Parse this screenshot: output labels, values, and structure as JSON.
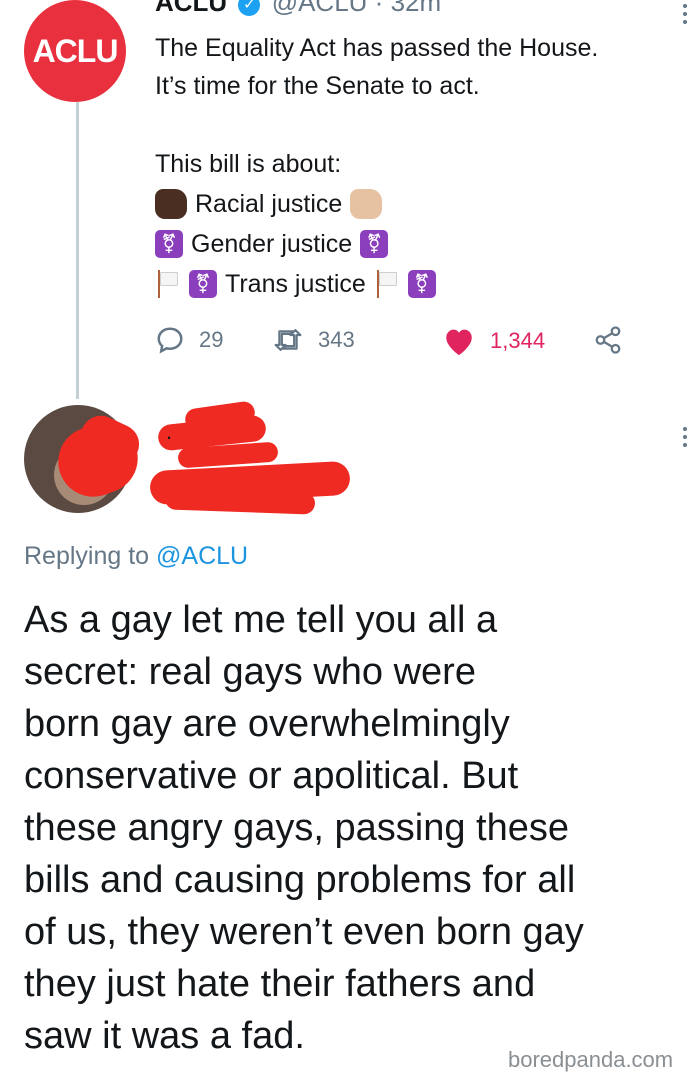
{
  "original_tweet": {
    "avatar_text": "ACLU",
    "author_name": "ACLU",
    "handle": "@ACLU",
    "separator": "·",
    "time": "32m",
    "text_line_1": "The Equality Act has passed the House.",
    "text_line_2": "It’s time for the Senate to act.",
    "list_intro": "This bill is about:",
    "list_items": [
      "Racial justice",
      "Gender justice",
      "Trans justice"
    ],
    "trans_symbol": "⚧",
    "stats": {
      "replies": "29",
      "retweets": "343",
      "likes": "1,344"
    }
  },
  "reply_tweet": {
    "name_fragment": ".",
    "replying_prefix": "Replying to ",
    "replying_mention": "@ACLU",
    "body_lines": [
      "As a gay let me tell you all a",
      "secret: real gays who were",
      "born gay are overwhelmingly",
      "conservative or apolitical. But",
      "these angry gays, passing these",
      "bills and causing problems for all",
      "of us, they weren’t even born gay",
      "they just hate their fathers and",
      "saw it was a fad."
    ]
  },
  "watermark": "boredpanda.com",
  "colors": {
    "aclu_red": "#e8303f",
    "twitter_blue": "#1da1f2",
    "like_red": "#e0245e",
    "muted_gray": "#657786",
    "redaction_red": "#ef2a23"
  },
  "icons": [
    "verified-icon",
    "reply-icon",
    "retweet-icon",
    "heart-icon",
    "share-icon",
    "more-icon"
  ]
}
